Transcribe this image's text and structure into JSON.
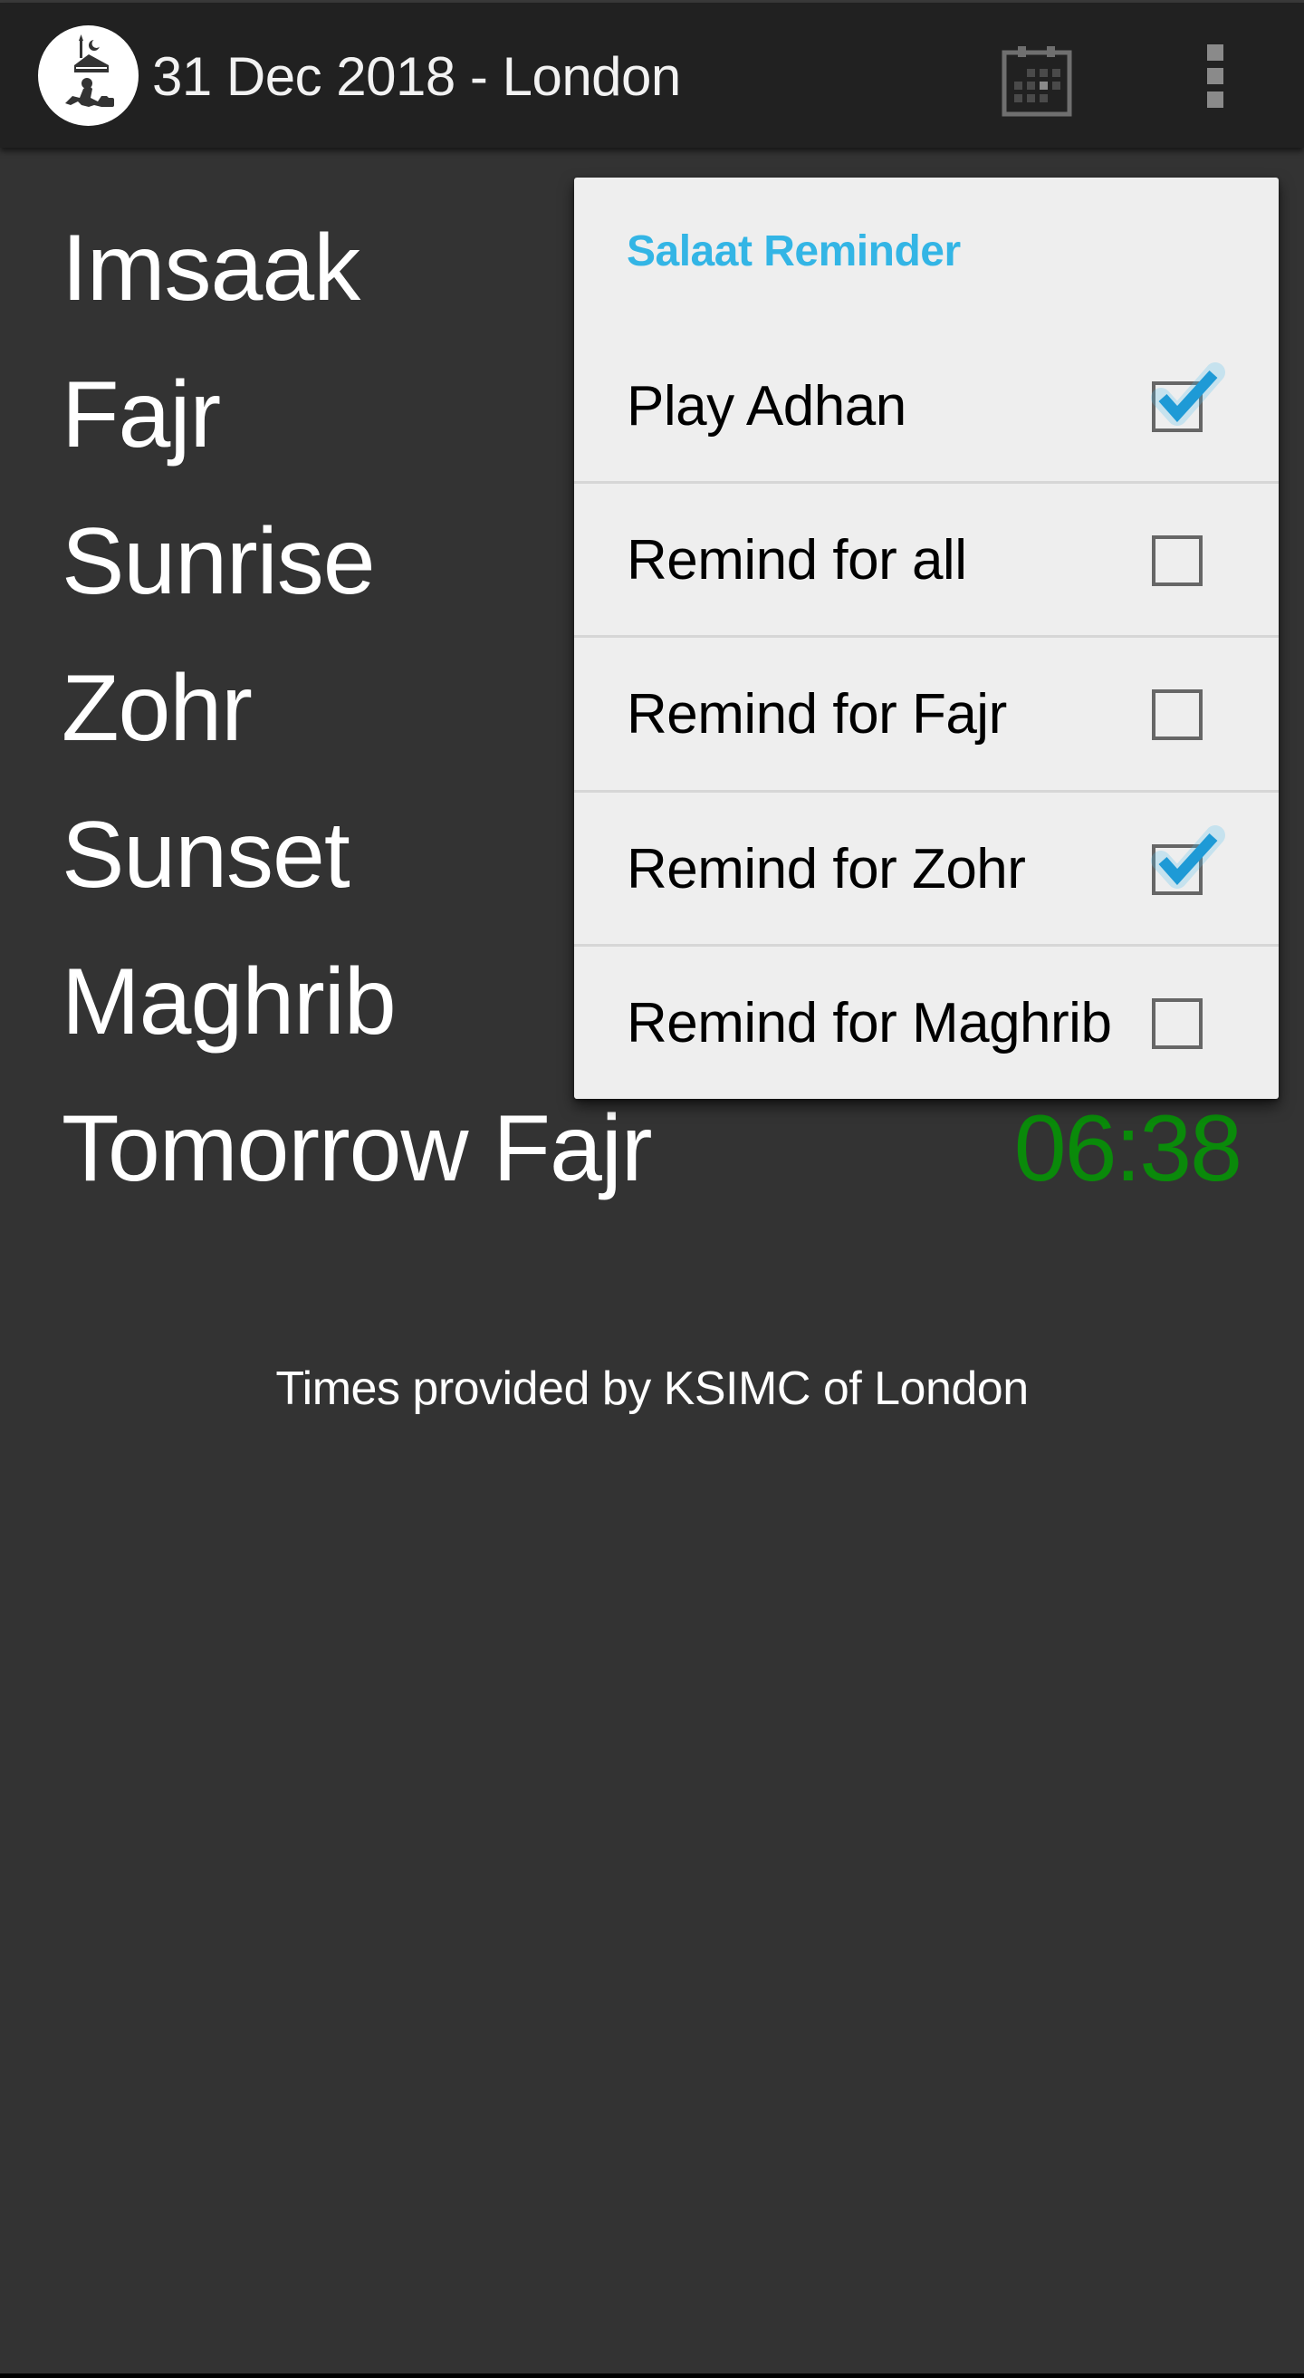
{
  "app_bar": {
    "title": "31 Dec 2018 - London",
    "logo_icon": "prayer-logo-icon",
    "actions": [
      {
        "name": "calendar",
        "icon": "calendar-icon"
      },
      {
        "name": "more",
        "icon": "overflow-menu-icon"
      }
    ]
  },
  "prayer_times": [
    {
      "name": "Imsaak",
      "time": ""
    },
    {
      "name": "Fajr",
      "time": ""
    },
    {
      "name": "Sunrise",
      "time": ""
    },
    {
      "name": "Zohr",
      "time": ""
    },
    {
      "name": "Sunset",
      "time": ""
    },
    {
      "name": "Maghrib",
      "time": ""
    },
    {
      "name": "Tomorrow Fajr",
      "time": "06:38"
    }
  ],
  "footer": {
    "text": "Times provided by KSIMC of London"
  },
  "reminder_menu": {
    "title": "Salaat Reminder",
    "items": [
      {
        "label": "Play Adhan",
        "checked": true
      },
      {
        "label": "Remind for all",
        "checked": false
      },
      {
        "label": "Remind for Fajr",
        "checked": false
      },
      {
        "label": "Remind for Zohr",
        "checked": true
      },
      {
        "label": "Remind for Maghrib",
        "checked": false
      }
    ]
  },
  "colors": {
    "accent": "#33b5e5",
    "check": "#1e9ad6",
    "next_time": "#0a8a0a",
    "background": "#333333",
    "app_bar": "#212121",
    "menu_background": "#eeeeee"
  }
}
